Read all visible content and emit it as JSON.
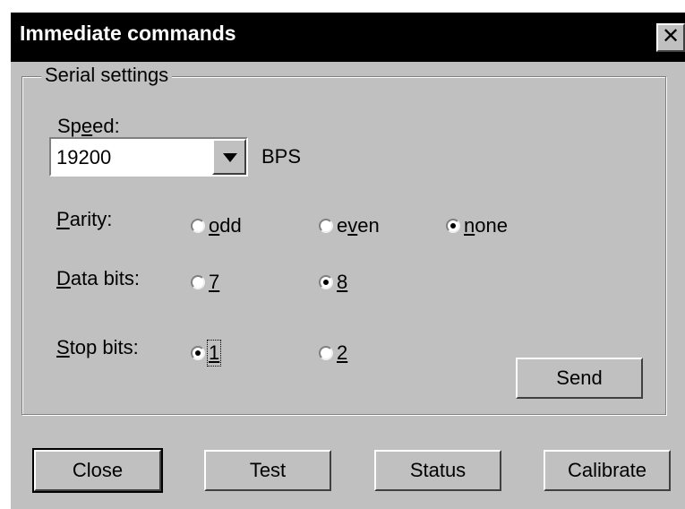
{
  "window": {
    "title": "Immediate commands",
    "close_glyph": "✕"
  },
  "group": {
    "label": "Serial settings"
  },
  "speed": {
    "label_pre": "Sp",
    "label_mnemonic": "e",
    "label_post": "ed:",
    "value": "19200",
    "unit": "BPS"
  },
  "parity": {
    "label_mnemonic": "P",
    "label_post": "arity:",
    "options": [
      {
        "pre": "",
        "mnemonic": "o",
        "post": "dd",
        "selected": false
      },
      {
        "pre": "e",
        "mnemonic": "v",
        "post": "en",
        "selected": false
      },
      {
        "pre": "",
        "mnemonic": "n",
        "post": "one",
        "selected": true
      }
    ]
  },
  "data_bits": {
    "label_mnemonic": "D",
    "label_post": "ata bits:",
    "options": [
      {
        "mnemonic": "7",
        "selected": false
      },
      {
        "mnemonic": "8",
        "selected": true
      }
    ]
  },
  "stop_bits": {
    "label_mnemonic": "S",
    "label_post": "top bits:",
    "options": [
      {
        "mnemonic": "1",
        "selected": true
      },
      {
        "mnemonic": "2",
        "selected": false
      }
    ]
  },
  "buttons": {
    "send": "Send",
    "close": "Close",
    "test": "Test",
    "status": "Status",
    "calibrate": "Calibrate"
  }
}
